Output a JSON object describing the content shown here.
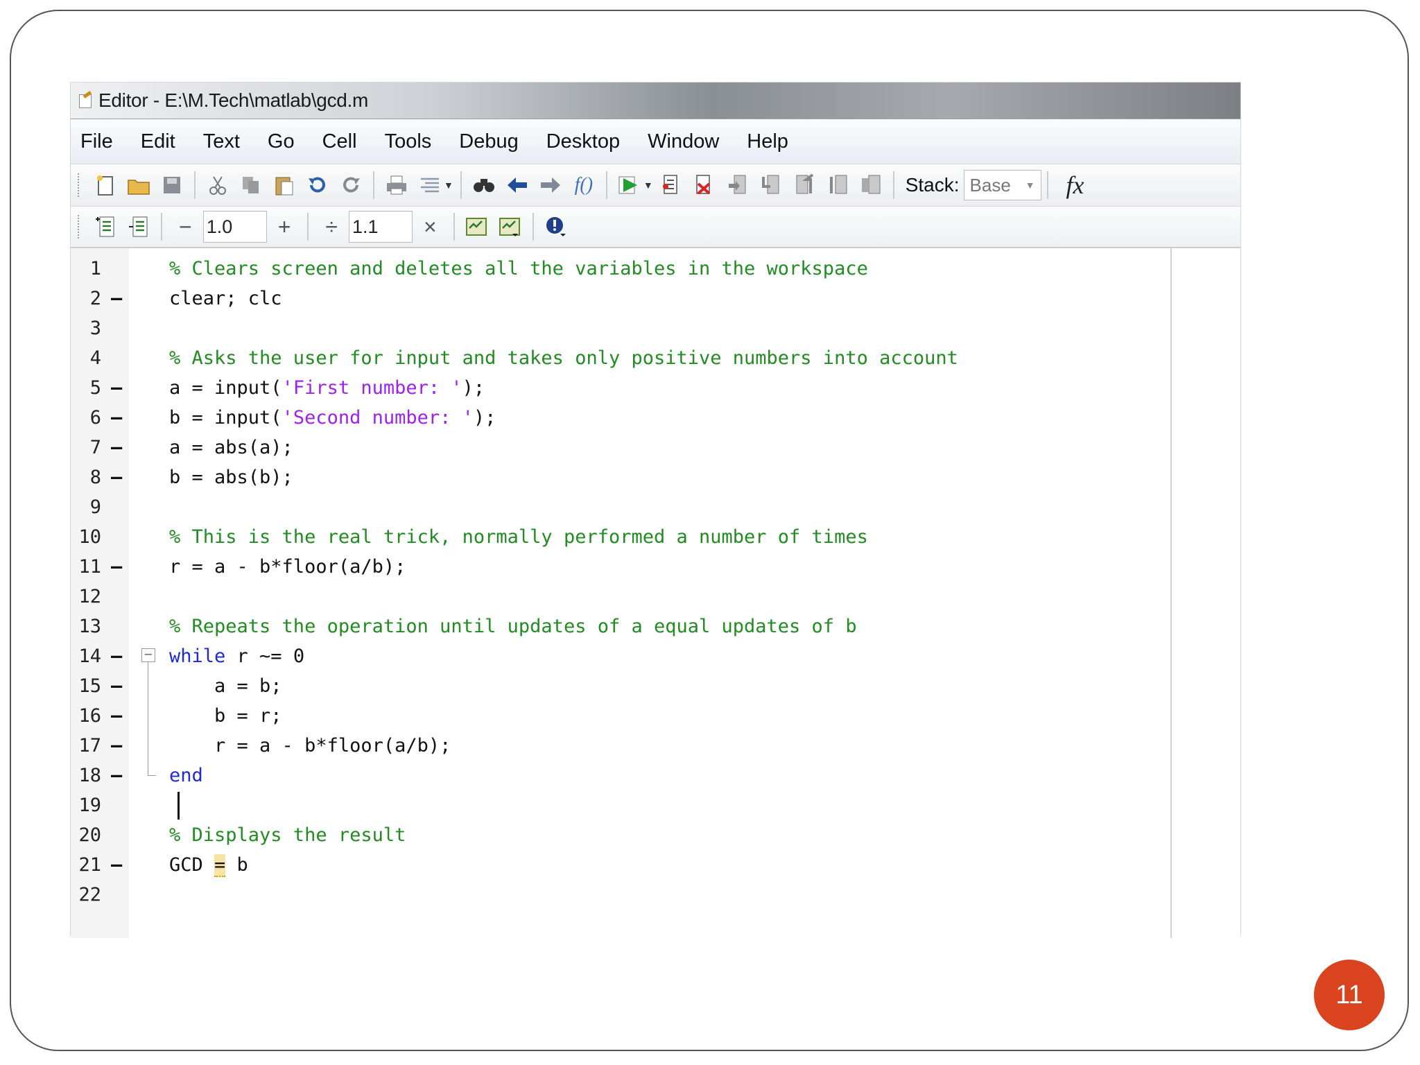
{
  "window": {
    "title": "Editor - E:\\M.Tech\\matlab\\gcd.m"
  },
  "menu": [
    "File",
    "Edit",
    "Text",
    "Go",
    "Cell",
    "Tools",
    "Debug",
    "Desktop",
    "Window",
    "Help"
  ],
  "toolbar": {
    "stack_label": "Stack:",
    "stack_value": "Base",
    "fx_label": "fx",
    "function_hint": "f()"
  },
  "cell_toolbar": {
    "decrement": "−",
    "value1": "1.0",
    "increment": "+",
    "divide": "÷",
    "value2": "1.1",
    "multiply": "×"
  },
  "code": {
    "line_numbers": [
      "1",
      "2",
      "3",
      "4",
      "5",
      "6",
      "7",
      "8",
      "9",
      "10",
      "11",
      "12",
      "13",
      "14",
      "15",
      "16",
      "17",
      "18",
      "19",
      "20",
      "21",
      "22"
    ],
    "executable_marker": "—",
    "lines": {
      "l1": "% Clears screen and deletes all the variables in the workspace",
      "l2": "clear; clc",
      "l4": "% Asks the user for input and takes only positive numbers into account",
      "l5_pre": "a = input(",
      "l5_str": "'First number: '",
      "l5_post": ");",
      "l6_pre": "b = input(",
      "l6_str": "'Second number: '",
      "l6_post": ");",
      "l7": "a = abs(a);",
      "l8": "b = abs(b);",
      "l10": "% This is the real trick, normally performed a number of times",
      "l11": "r = a - b*floor(a/b);",
      "l13": "% Repeats the operation until updates of a equal updates of b",
      "l14_kw": "while",
      "l14_rest": " r ~= 0",
      "l15": "    a = b;",
      "l16": "    b = r;",
      "l17": "    r = a - b*floor(a/b);",
      "l18_kw": "end",
      "l20": "% Displays the result",
      "l21_pre": "GCD ",
      "l21_hl": "=",
      "l21_post": " b"
    }
  },
  "page_number": "11",
  "colors": {
    "comment": "#228b22",
    "keyword": "#1f2ad6",
    "string": "#a020f0",
    "badge": "#d9441f"
  },
  "icons": [
    "new-file-icon",
    "open-folder-icon",
    "save-icon",
    "cut-icon",
    "copy-icon",
    "paste-icon",
    "undo-icon",
    "redo-icon",
    "print-icon",
    "comment-icon",
    "find-icon",
    "back-icon",
    "forward-icon",
    "function-icon",
    "run-icon",
    "breakpoint-set-icon",
    "breakpoint-clear-icon",
    "step-icon",
    "step-in-icon",
    "step-out-icon",
    "continue-icon",
    "exit-debug-icon",
    "insert-cell-icon",
    "cell-mode-icon",
    "eval-cell-icon",
    "eval-cell-advance-icon",
    "help-icon"
  ]
}
